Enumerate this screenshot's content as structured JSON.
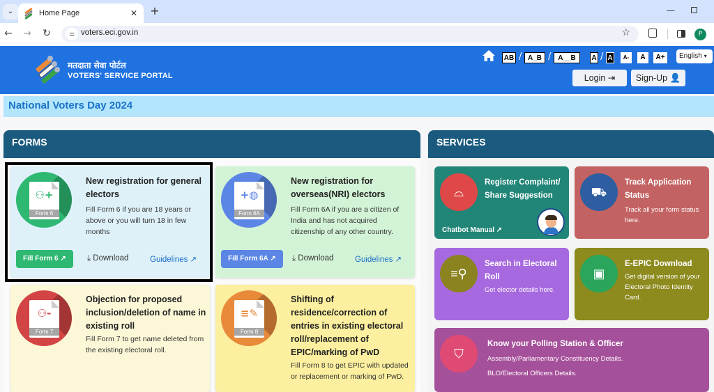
{
  "browser": {
    "tab_title": "Home Page",
    "url": "voters.eci.gov.in",
    "profile_initial": "P"
  },
  "header": {
    "brand_hindi": "मतदाता सेवा पोर्टल",
    "brand_english": "VOTERS' SERVICE PORTAL",
    "spacing_options": [
      "AB",
      "A_B",
      "A__B"
    ],
    "contrast_options": [
      "A",
      "A"
    ],
    "font_size_options": [
      "A-",
      "A",
      "A+"
    ],
    "language": "English",
    "login_label": "Login",
    "signup_label": "Sign-Up"
  },
  "banner": {
    "text": "National Voters Day 2024"
  },
  "forms": {
    "heading": "FORMS",
    "cards": [
      {
        "form_label": "Form 6",
        "title": "New registration for general electors",
        "description": "Fill Form 6 if you are 18 years or above or you will turn 18 in few months",
        "fill_label": "Fill Form 6",
        "download_label": "Download",
        "guidelines_label": "Guidelines",
        "color": "#2eb872",
        "bg": "#def1f9"
      },
      {
        "form_label": "Form 6A",
        "title": "New registration for overseas(NRI) electors",
        "description": "Fill Form 6A if you are a citizen of India and has not acquired citizenship of any other country.",
        "fill_label": "Fill Form 6A",
        "download_label": "Download",
        "guidelines_label": "Guidelines",
        "color": "#5b86e5",
        "bg": "#d3f3d6"
      },
      {
        "form_label": "Form 7",
        "title": "Objection for proposed inclusion/deletion of name in existing roll",
        "description": "Fill Form 7 to get name deleted from the existing electoral roll.",
        "color": "#d34545",
        "bg": "#fcf8d7"
      },
      {
        "form_label": "Form 8",
        "title": "Shifting of residence/correction of entries in existing electoral roll/replacement of EPIC/marking of PwD",
        "description": "Fill Form 8 to get EPIC with updated or replacement or marking of PwD.",
        "color": "#e88a3a",
        "bg": "#fcef9f"
      }
    ]
  },
  "services": {
    "heading": "SERVICES",
    "cards": [
      {
        "title": "Register Complaint/ Share Suggestion",
        "link": "Chatbot Manual",
        "mascot": "Voter Mitra",
        "bg": "#218577",
        "icon_bg": "#df4848"
      },
      {
        "title": "Track Application Status",
        "description": "Track all your form status here.",
        "bg": "#c36262",
        "icon_bg": "#2e5ea1"
      },
      {
        "title": "Search in Electoral Roll",
        "description": "Get elector details here.",
        "bg": "#a769e0",
        "icon_bg": "#8b8320"
      },
      {
        "title": "E-EPIC Download",
        "description": "Get digital version of your Electoral Photo Identity Card.",
        "bg": "#8d8a1e",
        "icon_bg": "#2aa55b"
      },
      {
        "title": "Know your Polling Station & Officer",
        "lines": [
          "Assembly/Parliamentary Constituency Details.",
          "BLO/Electoral Officers Details."
        ],
        "bg": "#a5509a",
        "icon_bg": "#df4a74"
      }
    ]
  }
}
